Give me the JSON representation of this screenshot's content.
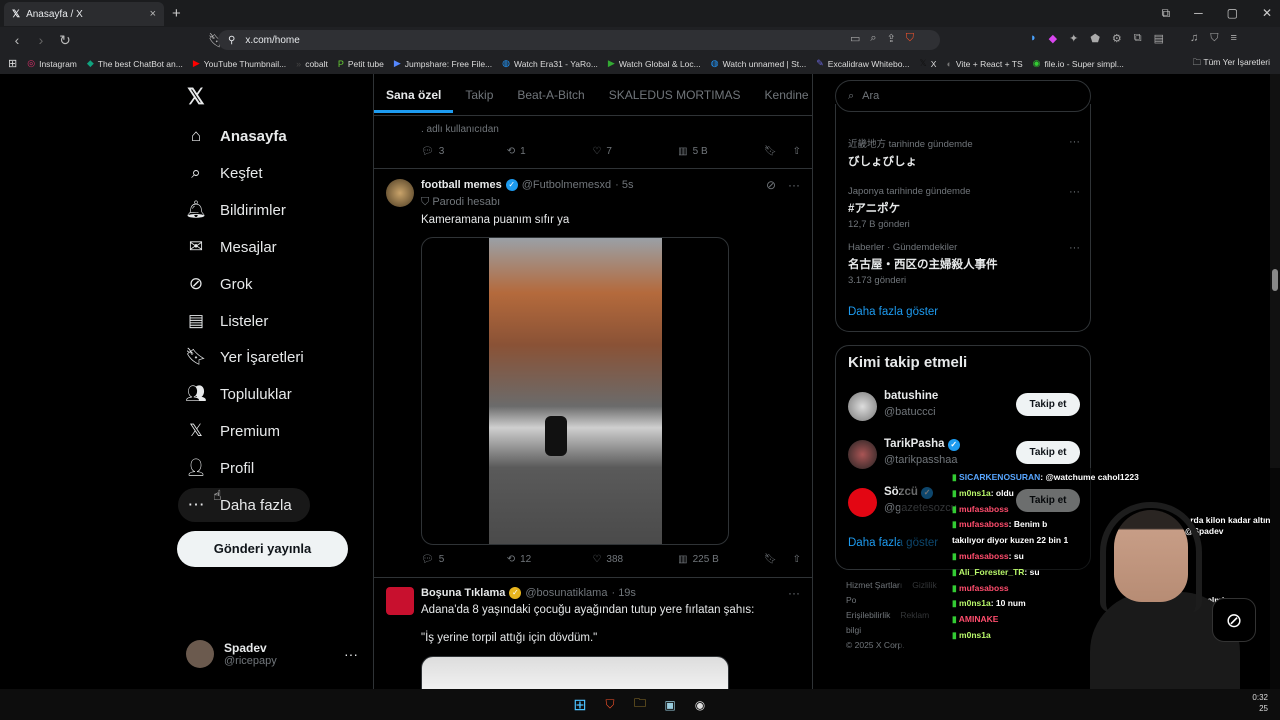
{
  "browser": {
    "tab_title": "Anasayfa / X",
    "tab_close": "×",
    "new_tab": "+",
    "url": "x.com/home",
    "bookmarks": [
      "Instagram",
      "The best ChatBot an...",
      "YouTube Thumbnail...",
      "cobalt",
      "Petit tube",
      "Jumpshare: Free File...",
      "Watch Era31 - YaRo...",
      "Watch Global & Loc...",
      "Watch unnamed | St...",
      "Excalidraw Whitebo...",
      "X",
      "Vite + React + TS",
      "file.io - Super simpl..."
    ],
    "all_bookmarks": "Tüm Yer İşaretleri"
  },
  "sidebar": {
    "items": [
      {
        "label": "Anasayfa",
        "icon": "home-icon"
      },
      {
        "label": "Keşfet",
        "icon": "search-icon"
      },
      {
        "label": "Bildirimler",
        "icon": "bell-icon"
      },
      {
        "label": "Mesajlar",
        "icon": "mail-icon"
      },
      {
        "label": "Grok",
        "icon": "grok-icon"
      },
      {
        "label": "Listeler",
        "icon": "list-icon"
      },
      {
        "label": "Yer İşaretleri",
        "icon": "bookmark-icon"
      },
      {
        "label": "Topluluklar",
        "icon": "people-icon"
      },
      {
        "label": "Premium",
        "icon": "x-logo-icon"
      },
      {
        "label": "Profil",
        "icon": "person-icon"
      },
      {
        "label": "Daha fazla",
        "icon": "more-circle-icon"
      }
    ],
    "post_button": "Gönderi yayınla",
    "account": {
      "name": "Spadev",
      "handle": "@ricepapy",
      "more": "···"
    }
  },
  "feed": {
    "tabs": [
      "Sana özel",
      "Takip",
      "Beat-A-Bitch",
      "SKALEDUS MORTIMAS",
      "Kendine Müz"
    ],
    "prev_fragment": ". adlı kullanıcıdan",
    "prev_actions": {
      "replies": "3",
      "reposts": "1",
      "likes": "7",
      "views": "5 B"
    },
    "post1": {
      "name": "football memes",
      "handle": "@Futbolmemesxd",
      "time": "· 5s",
      "parody": "Parodi hesabı",
      "text": "Kameramana puanım sıfır ya",
      "actions": {
        "replies": "5",
        "reposts": "12",
        "likes": "388",
        "views": "225 B"
      }
    },
    "post2": {
      "name": "Boşuna Tıklama",
      "handle": "@bosunatiklama",
      "time": "· 19s",
      "text": "Adana'da 8 yaşındaki çocuğu ayağından tutup yere fırlatan şahıs:",
      "quote": "\"İş yerine torpil attığı için dövdüm.\""
    }
  },
  "right": {
    "search_placeholder": "Ara",
    "trends": [
      {
        "context": "近畿地方 tarihinde gündemde",
        "title": "びしょびしょ",
        "count": ""
      },
      {
        "context": "Japonya tarihinde gündemde",
        "title": "#アニポケ",
        "count": "12,7 B gönderi"
      },
      {
        "context": "Haberler · Gündemdekiler",
        "title": "名古屋・西区の主婦殺人事件",
        "count": "3.173 gönderi"
      }
    ],
    "trends_more": "Daha fazla göster",
    "who_title": "Kimi takip etmeli",
    "who": [
      {
        "name": "batushine",
        "handle": "@batuccci",
        "verified": false
      },
      {
        "name": "TarikPasha",
        "handle": "@tarikpasshaa",
        "verified": true
      },
      {
        "name": "Sözcü",
        "handle": "@gazetesozcu",
        "verified": true
      }
    ],
    "follow_label": "Takip et",
    "who_more": "Daha fazla göster",
    "footer": [
      "Hizmet Şartları",
      "Gizlilik Po",
      "Erişilebilirlik",
      "Reklam bilgi",
      "© 2025 X Corp."
    ]
  },
  "stream": {
    "chat": [
      {
        "user": "SICARKENOSURAN",
        "msg": ": @watchume cahol1223",
        "cls": "u1"
      },
      {
        "user": "m0ns1a",
        "msg": ": oldu",
        "cls": "u2"
      },
      {
        "user": "mufasaboss",
        "msg": "",
        "cls": "u3"
      },
      {
        "user": "mufasaboss",
        "msg": ": Benim b",
        "cls": "u3"
      },
      {
        "user": "",
        "msg": "takılıyor diyor kuzen 22 bin 1",
        "cls": "m"
      },
      {
        "user": "mufasaboss",
        "msg": ": su",
        "cls": "u3"
      },
      {
        "user": "Ali_Forester_TR",
        "msg": ": su",
        "cls": "u2"
      },
      {
        "user": "mufasaboss",
        "msg": "",
        "cls": "u3"
      },
      {
        "user": "m0ns1a",
        "msg": ": 10 num",
        "cls": "u2"
      },
      {
        "user": "AMINAKE",
        "msg": "",
        "cls": "u3"
      },
      {
        "user": "m0ns1a",
        "msg": "",
        "cls": "u2"
      }
    ],
    "side_text": [
      "orda kilon kadar altın",
      "@Spadev",
      "",
      "",
      "",
      "",
      "enk gelmis"
    ],
    "clock": [
      "0:32",
      "25"
    ]
  }
}
